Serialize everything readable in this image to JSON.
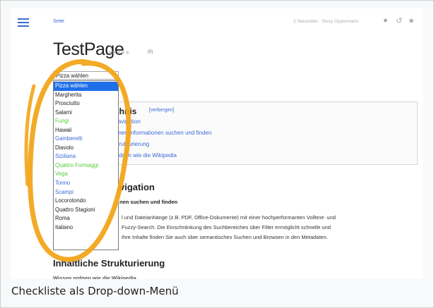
{
  "header": {
    "tab_label": "Seite",
    "meta_text": "2 Sekunden · Sissy Oppermann",
    "icons": [
      "menu-icon",
      "comments-icon",
      "history-icon",
      "star-icon"
    ]
  },
  "page": {
    "title": "TestPage",
    "stars": "★★★★★",
    "rating_count": "(0)"
  },
  "dropdown": {
    "selected": "Pizza wählen",
    "options": [
      "Pizza wählen",
      "Margherita",
      "Prosciutto",
      "Salami",
      "Fungi",
      "Hawaii",
      "Gamberetti",
      "Diavolo",
      "Siziliana",
      "Quattro Formaggi",
      "Vega",
      "Tonno",
      "Scampi",
      "Locorotondo",
      "Quattro Stagioni",
      "Roma",
      "Italiano"
    ],
    "option_colors": [
      "#ffffff",
      "#222222",
      "#222222",
      "#222222",
      "#55cc3a",
      "#222222",
      "#3b6bd6",
      "#222222",
      "#3b6bd6",
      "#55cc3a",
      "#55cc3a",
      "#3b6bd6",
      "#3b6bd6",
      "#222222",
      "#222222",
      "#222222",
      "#222222"
    ]
  },
  "toc": {
    "title": "chnis",
    "hide_label": "[verbergen]",
    "items": [
      "Navigation",
      "ionen Informationen suchen und finden",
      "Strukturierung",
      "ordnen wie die Wikipedia"
    ]
  },
  "section1": {
    "heading": "vigation",
    "subheading": "nen suchen und finden",
    "lines": [
      "l und Dateianhänge (z.B. PDF, Office-Dokumente) mit einer hochperformanten Volltext- und",
      "Fuzzy-Search. Die Einschränkung des Suchbereiches über Filter ermöglicht schnelle und",
      "Ihre Inhalte finden Sie auch über semantisches Suchen und Browsen in den Metadaten."
    ]
  },
  "section2": {
    "heading": "Inhaltliche Strukturierung",
    "cut_line": "Wissen ordnen wie die Wikipedia"
  },
  "caption": "Checkliste als Drop-down-Menü",
  "colors": {
    "link": "#3b6bd6",
    "selected_bg": "#1e6fe8",
    "annotation": "#f2a51a"
  }
}
